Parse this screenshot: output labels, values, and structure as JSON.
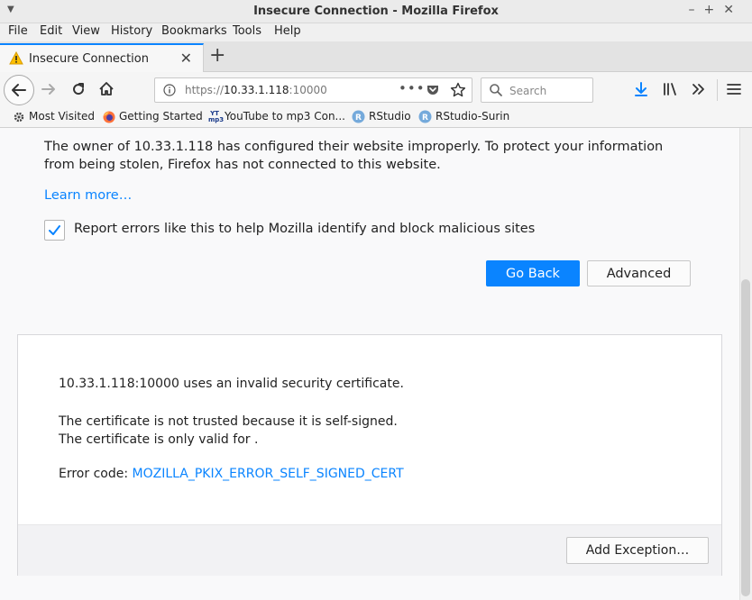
{
  "window": {
    "title": "Insecure Connection - Mozilla Firefox"
  },
  "menubar": {
    "items": [
      "File",
      "Edit",
      "View",
      "History",
      "Bookmarks",
      "Tools",
      "Help"
    ]
  },
  "tab": {
    "label": "Insecure Connection",
    "icon": "warning-icon"
  },
  "navbar": {
    "url_prefix": "https://",
    "url_host": "10.33.1.118",
    "url_port": ":10000",
    "search_placeholder": "Search"
  },
  "bookmarks": [
    {
      "label": "Most Visited",
      "icon": "gear-icon"
    },
    {
      "label": "Getting Started",
      "icon": "firefox-icon"
    },
    {
      "label": "YouTube to mp3 Con...",
      "icon": "yt-mp3-icon"
    },
    {
      "label": "RStudio",
      "icon": "rstudio-icon"
    },
    {
      "label": "RStudio-Surin",
      "icon": "rstudio-icon"
    }
  ],
  "error_page": {
    "description": "The owner of 10.33.1.118 has configured their website improperly. To protect your information from being stolen, Firefox has not connected to this website.",
    "learn_more": "Learn more…",
    "report_label": "Report errors like this to help Mozilla identify and block malicious sites",
    "report_checked": true,
    "go_back": "Go Back",
    "advanced": "Advanced",
    "accent_color": "#0a84ff"
  },
  "advanced_panel": {
    "line1": "10.33.1.118:10000 uses an invalid security certificate.",
    "line2": "The certificate is not trusted because it is self-signed.",
    "line3": "The certificate is only valid for .",
    "error_code_label": "Error code: ",
    "error_code": "MOZILLA_PKIX_ERROR_SELF_SIGNED_CERT",
    "add_exception": "Add Exception…"
  }
}
